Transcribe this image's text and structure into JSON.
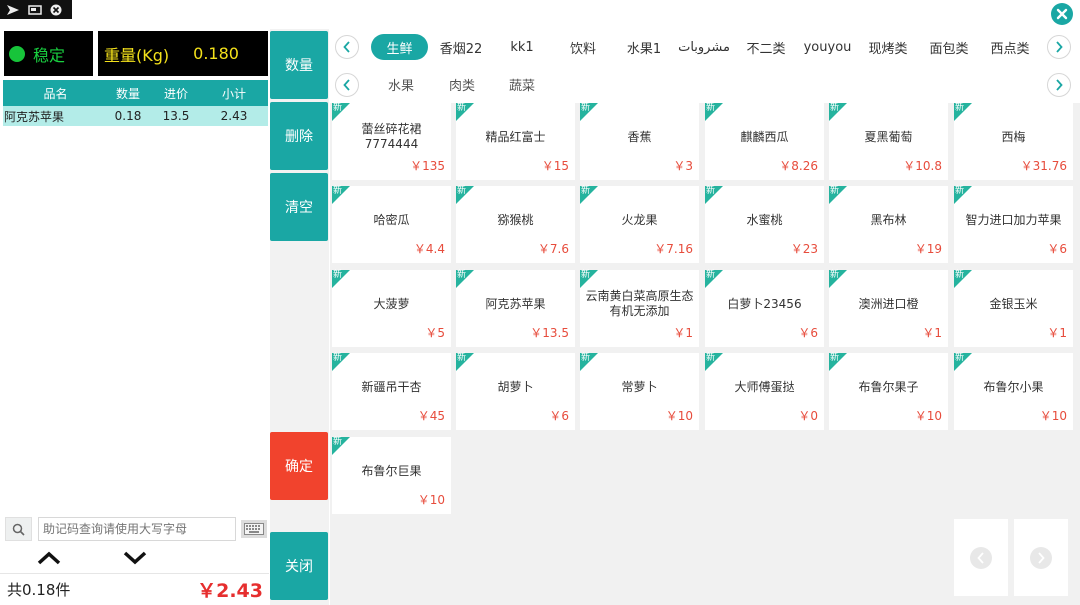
{
  "scale": {
    "status": "稳定",
    "weight_label": "重量(Kg)",
    "weight_value": "0.180"
  },
  "cart": {
    "headers": [
      "品名",
      "数量",
      "进价",
      "小计"
    ],
    "rows": [
      {
        "name": "阿克苏苹果",
        "qty": "0.18",
        "price": "13.5",
        "subtotal": "2.43"
      }
    ]
  },
  "search": {
    "placeholder": "助记码查询请使用大写字母"
  },
  "footer": {
    "count": "共0.18件",
    "total": "￥2.43"
  },
  "actions": {
    "qty": "数量",
    "delete": "删除",
    "clear": "清空",
    "confirm": "确定",
    "close": "关闭"
  },
  "categories": [
    "生鲜",
    "香烟22",
    "kk1",
    "饮料",
    "水果1",
    "مشروبات",
    "不二类",
    "youyou",
    "现烤类",
    "面包类",
    "西点类"
  ],
  "subcategories": [
    "水果",
    "肉类",
    "蔬菜"
  ],
  "badge": "新",
  "products": [
    {
      "name": "蕾丝碎花裙7774444",
      "price": "￥135"
    },
    {
      "name": "精品红富士",
      "price": "￥15"
    },
    {
      "name": "香蕉",
      "price": "￥3"
    },
    {
      "name": "麒麟西瓜",
      "price": "￥8.26"
    },
    {
      "name": "夏黑葡萄",
      "price": "￥10.8"
    },
    {
      "name": "西梅",
      "price": "￥31.76"
    },
    {
      "name": "哈密瓜",
      "price": "￥4.4"
    },
    {
      "name": "猕猴桃",
      "price": "￥7.6"
    },
    {
      "name": "火龙果",
      "price": "￥7.16"
    },
    {
      "name": "水蜜桃",
      "price": "￥23"
    },
    {
      "name": "黑布林",
      "price": "￥19"
    },
    {
      "name": "智力进口加力苹果",
      "price": "￥6"
    },
    {
      "name": "大菠萝",
      "price": "￥5"
    },
    {
      "name": "阿克苏苹果",
      "price": "￥13.5"
    },
    {
      "name": "云南黄白菜高原生态有机无添加",
      "price": "￥1"
    },
    {
      "name": "白萝卜23456",
      "price": "￥6"
    },
    {
      "name": "澳洲进口橙",
      "price": "￥1"
    },
    {
      "name": "金银玉米",
      "price": "￥1"
    },
    {
      "name": "新疆吊干杏",
      "price": "￥45"
    },
    {
      "name": "胡萝卜",
      "price": "￥6"
    },
    {
      "name": "常萝卜",
      "price": "￥10"
    },
    {
      "name": "大师傅蛋挞",
      "price": "￥0"
    },
    {
      "name": "布鲁尔果子",
      "price": "￥10"
    },
    {
      "name": "布鲁尔小果",
      "price": "￥10"
    },
    {
      "name": "布鲁尔巨果",
      "price": "￥10"
    }
  ],
  "colors": {
    "accent": "#1aa7a4",
    "danger": "#f1432d",
    "price": "#e74c3c",
    "scale_text": "#f3e11b",
    "stable": "#17c43a"
  }
}
